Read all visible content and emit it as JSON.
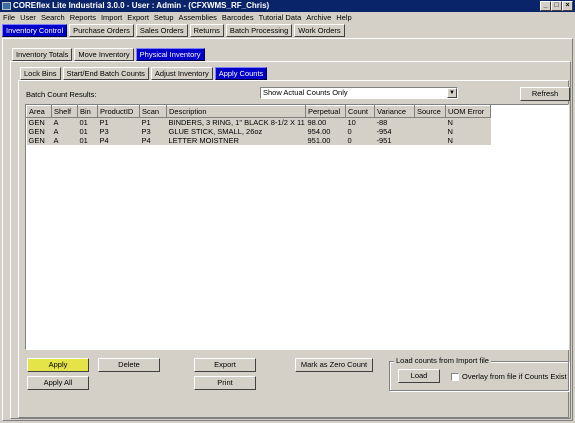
{
  "window": {
    "title": "COREflex Lite Industrial 3.0.0 - User : Admin - (CFXWMS_RF_Chris)"
  },
  "menu": [
    "File",
    "User",
    "Search",
    "Reports",
    "Import",
    "Export",
    "Setup",
    "Assemblies",
    "Barcodes",
    "Tutorial Data",
    "Archive",
    "Help"
  ],
  "main_tabs": [
    "Inventory Control",
    "Purchase Orders",
    "Sales Orders",
    "Returns",
    "Batch Processing",
    "Work Orders"
  ],
  "sub_tabs": [
    "Inventory Totals",
    "Move Inventory",
    "Physical Inventory"
  ],
  "sub_sub_tabs": [
    "Lock Bins",
    "Start/End Batch Counts",
    "Adjust Inventory",
    "Apply Counts"
  ],
  "batch": {
    "label": "Batch Count Results:",
    "filter_value": "Show Actual Counts Only",
    "refresh_label": "Refresh"
  },
  "grid": {
    "columns": [
      "Area",
      "Shelf",
      "Bin",
      "ProductID",
      "Scan",
      "Description",
      "Perpetual",
      "Count",
      "Variance",
      "Source",
      "UOM Error"
    ],
    "rows": [
      [
        "GEN",
        "A",
        "01",
        "P1",
        "P1",
        "BINDERS, 3 RING, 1\" BLACK 8-1/2 X 11",
        "98.00",
        "10",
        "-88",
        "",
        "N"
      ],
      [
        "GEN",
        "A",
        "01",
        "P3",
        "P3",
        "GLUE STICK, SMALL, 26oz",
        "954.00",
        "0",
        "-954",
        "",
        "N"
      ],
      [
        "GEN",
        "A",
        "01",
        "P4",
        "P4",
        "LETTER MOISTNER",
        "951.00",
        "0",
        "-951",
        "",
        "N"
      ]
    ]
  },
  "buttons": {
    "apply": "Apply",
    "apply_all": "Apply All",
    "delete": "Delete",
    "export": "Export",
    "print": "Print",
    "mark_zero": "Mark as Zero Count",
    "load": "Load"
  },
  "load_group": {
    "title": "Load counts from Import file",
    "overlay_label": "Overlay from file if Counts Exist"
  },
  "colors": {
    "title_bar": "#0a246a",
    "active_tab": "#0000c8",
    "apply_button": "#e4e448",
    "face": "#d4d0c8"
  }
}
